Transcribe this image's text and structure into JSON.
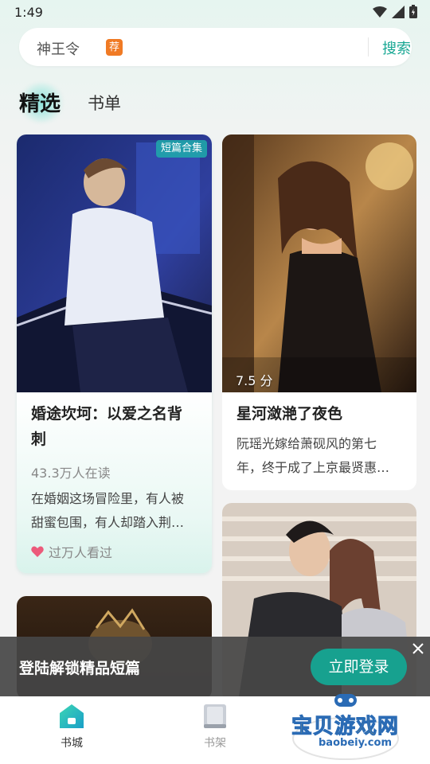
{
  "status_bar": {
    "time": "1:49"
  },
  "search": {
    "query": "神王令",
    "tag": "荐",
    "button_label": "搜索"
  },
  "tabs": [
    {
      "label": "精选",
      "active": true
    },
    {
      "label": "书单",
      "active": false
    }
  ],
  "cards": [
    {
      "badge": "短篇合集",
      "title_line1": "婚途坎坷：以爱之名背",
      "title_line2": "刺",
      "readers": "43.3万人在读",
      "desc_line1": "在婚姻这场冒险里，有人被",
      "desc_line2": "甜蜜包围，有人却踏入荆…",
      "footer": "过万人看过"
    },
    {
      "score": "7.5 分",
      "title": "星河潋滟了夜色",
      "desc_line1": "阮瑶光嫁给萧砚风的第七",
      "desc_line2": "年，终于成了上京最贤惠…"
    }
  ],
  "login_banner": {
    "text": "登陆解锁精品短篇",
    "button_label": "立即登录"
  },
  "bottom_nav": [
    {
      "label": "书城",
      "icon": "bookstore-icon",
      "active": true
    },
    {
      "label": "书架",
      "icon": "bookshelf-icon",
      "active": false
    }
  ],
  "watermark": {
    "title": "宝贝游戏网",
    "url": "baobeiy.com"
  },
  "colors": {
    "accent": "#17a793",
    "tag": "#f07a24",
    "banner": "#464646"
  }
}
